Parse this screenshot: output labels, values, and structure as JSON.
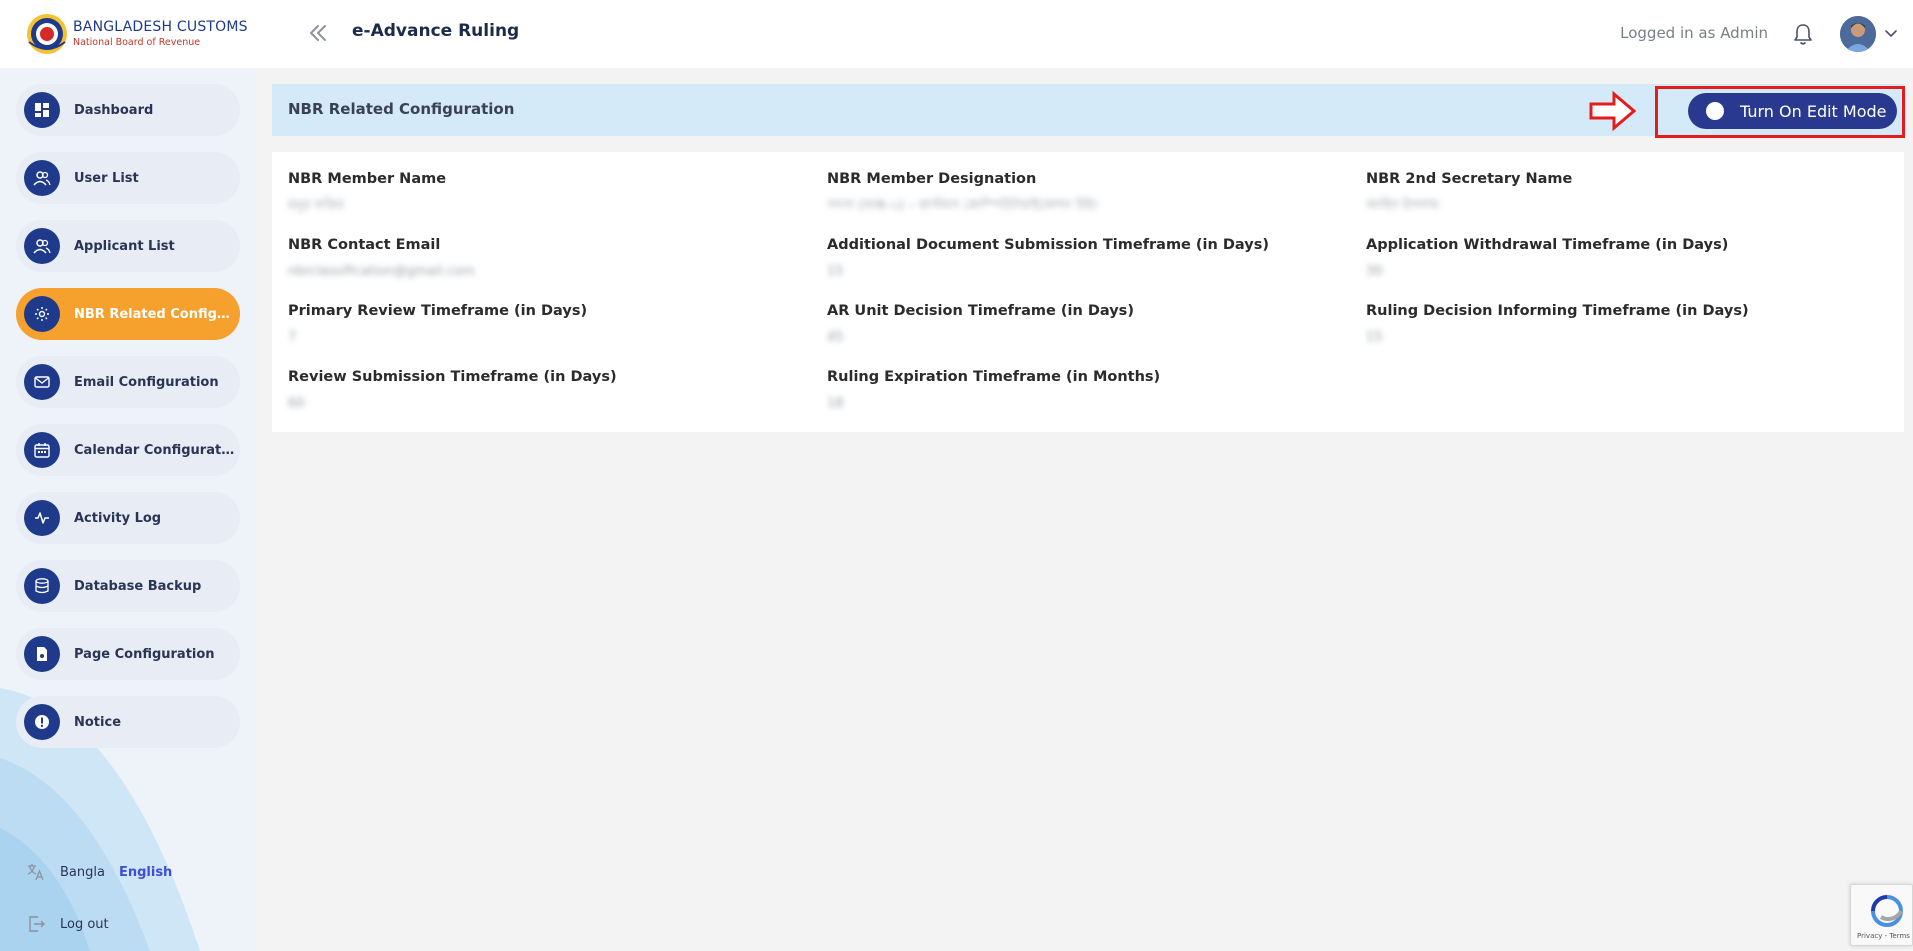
{
  "header": {
    "brand_title": "BANGLADESH CUSTOMS",
    "brand_subtitle": "National Board of Revenue",
    "app_title": "e-Advance Ruling",
    "logged_in_text": "Logged in as Admin"
  },
  "sidebar": {
    "items": [
      {
        "label": "Dashboard",
        "icon": "dashboard-icon"
      },
      {
        "label": "User List",
        "icon": "users-icon"
      },
      {
        "label": "Applicant List",
        "icon": "users-icon"
      },
      {
        "label": "NBR Related Configurati...",
        "icon": "settings-icon",
        "active": true
      },
      {
        "label": "Email Configuration",
        "icon": "mail-icon"
      },
      {
        "label": "Calendar Configuration",
        "icon": "calendar-icon"
      },
      {
        "label": "Activity Log",
        "icon": "activity-icon"
      },
      {
        "label": "Database Backup",
        "icon": "database-icon"
      },
      {
        "label": "Page Configuration",
        "icon": "page-icon"
      },
      {
        "label": "Notice",
        "icon": "alert-icon"
      }
    ],
    "lang_bangla": "Bangla",
    "lang_english": "English",
    "logout_label": "Log out"
  },
  "main": {
    "section_title": "NBR Related Configuration",
    "edit_toggle_label": "Turn On Edit Mode",
    "fields": [
      {
        "label": "NBR Member Name",
        "value": "মনুর ফকির"
      },
      {
        "label": "NBR Member Designation",
        "value": "সদস্য (শুল্ক-২) – কাস্টমস কোম্পিউটারাইজেশন উইং"
      },
      {
        "label": "NBR 2nd Secretary Name",
        "value": "জাহিদ ইসলাম"
      },
      {
        "label": "NBR Contact Email",
        "value": "nbrclassification@gmail.com"
      },
      {
        "label": "Additional Document Submission Timeframe (in Days)",
        "value": "15"
      },
      {
        "label": "Application Withdrawal Timeframe (in Days)",
        "value": "30"
      },
      {
        "label": "Primary Review Timeframe (in Days)",
        "value": "7"
      },
      {
        "label": "AR Unit Decision Timeframe (in Days)",
        "value": "45"
      },
      {
        "label": "Ruling Decision Informing Timeframe (in Days)",
        "value": "15"
      },
      {
        "label": "Review Submission Timeframe (in Days)",
        "value": "60"
      },
      {
        "label": "Ruling Expiration Timeframe (in Months)",
        "value": "18"
      }
    ]
  },
  "recaptcha": {
    "text": "Privacy - Terms"
  },
  "colors": {
    "primary": "#1f3a8a",
    "active_nav": "#f6a12d",
    "toggle_bg": "#2a3990",
    "highlight": "#e51c1c",
    "section_header_bg": "#d4eaf8"
  }
}
